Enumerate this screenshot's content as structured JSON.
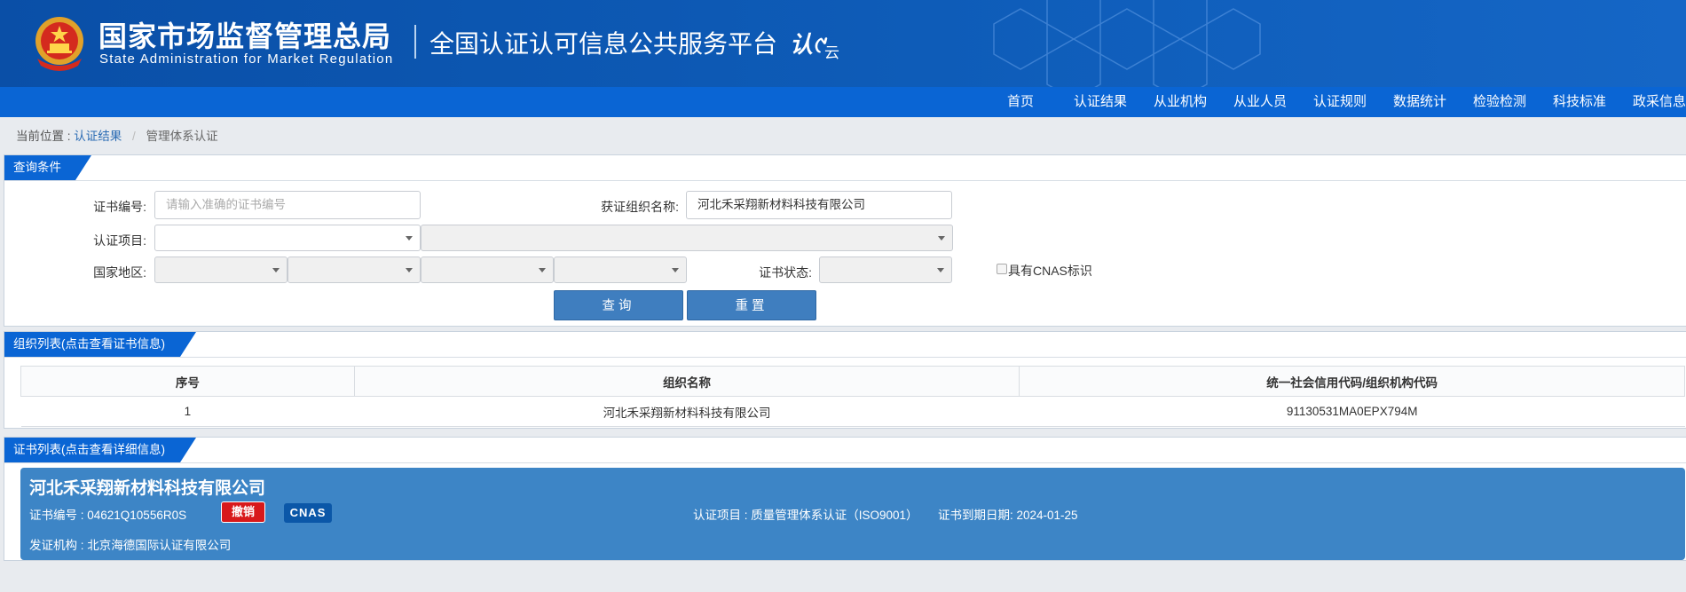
{
  "header": {
    "org_name_cn": "国家市场监督管理总局",
    "org_name_en": "State Administration for Market Regulation",
    "platform_title": "全国认证认可信息公共服务平台",
    "logo_text": "认",
    "logo_sub": "云"
  },
  "nav": {
    "items": [
      {
        "label": "首页"
      },
      {
        "label": "认证结果"
      },
      {
        "label": "从业机构"
      },
      {
        "label": "从业人员"
      },
      {
        "label": "认证规则"
      },
      {
        "label": "数据统计"
      },
      {
        "label": "检验检测"
      },
      {
        "label": "科技标准"
      },
      {
        "label": "政采信息"
      }
    ]
  },
  "breadcrumb": {
    "prefix": "当前位置 :",
    "link": "认证结果",
    "separator": "/",
    "current": "管理体系认证"
  },
  "query": {
    "title": "查询条件",
    "cert_no_label": "证书编号:",
    "cert_no_placeholder": "请输入准确的证书编号",
    "org_name_label": "获证组织名称:",
    "org_name_value": "河北禾采翔新材料科技有限公司",
    "project_label": "认证项目:",
    "region_label": "国家地区:",
    "status_label": "证书状态:",
    "cnas_label": "具有CNAS标识",
    "search_button": "查询",
    "reset_button": "重置"
  },
  "org_list": {
    "title": "组织列表(点击查看证书信息)",
    "columns": [
      "序号",
      "组织名称",
      "统一社会信用代码/组织机构代码"
    ],
    "rows": [
      [
        "1",
        "河北禾采翔新材料科技有限公司",
        "91130531MA0EPX794M"
      ]
    ]
  },
  "cert_list": {
    "title": "证书列表(点击查看详细信息)",
    "card": {
      "org_name": "河北禾采翔新材料科技有限公司",
      "cert_no": "证书编号 : 04621Q10556R0S",
      "status_badge": "撤销",
      "cnas_badge": "CNAS",
      "project": "认证项目 : 质量管理体系认证（ISO9001）",
      "expiry": "证书到期日期: 2024-01-25",
      "issuer": "发证机构 : 北京海德国际认证有限公司"
    }
  },
  "colors": {
    "header_blue": "#0e5cb8",
    "nav_blue": "#0a65d4",
    "button_blue": "#3f7ebf",
    "card_blue": "#3d85c6",
    "revoked_red": "#d8191b"
  }
}
